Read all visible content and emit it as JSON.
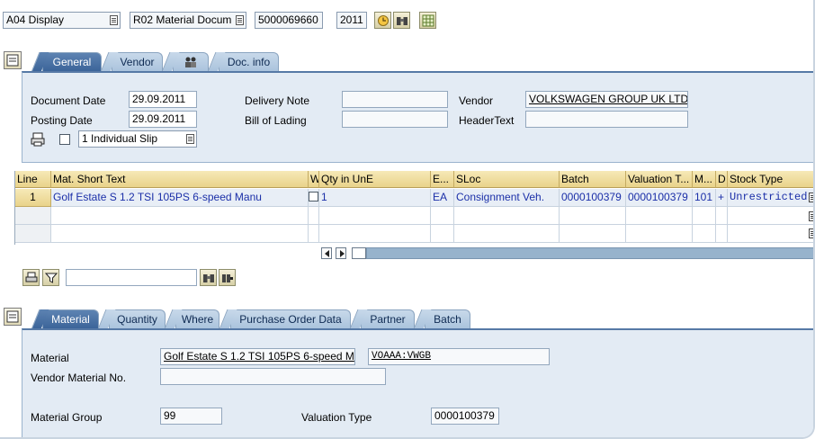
{
  "toolbar": {
    "action": "A04 Display",
    "document_type": "R02 Material Docum",
    "document_number": "5000069660",
    "year": "2011"
  },
  "header_tabs": {
    "general": "General",
    "vendor": "Vendor",
    "doc_info": "Doc. info"
  },
  "general": {
    "document_date_label": "Document Date",
    "document_date": "29.09.2011",
    "posting_date_label": "Posting Date",
    "posting_date": "29.09.2011",
    "slip_option": "1 Individual Slip",
    "delivery_note_label": "Delivery Note",
    "delivery_note": "",
    "bill_of_lading_label": "Bill of Lading",
    "bill_of_lading": "",
    "vendor_label": "Vendor",
    "vendor": "VOLKSWAGEN GROUP UK LTD",
    "header_text_label": "HeaderText",
    "header_text": ""
  },
  "items_table": {
    "columns": [
      "Line",
      "Mat. Short Text",
      "W",
      "Qty in UnE",
      "E...",
      "SLoc",
      "Batch",
      "Valuation T...",
      "M...",
      "D",
      "Stock Type"
    ],
    "rows": [
      {
        "line": "1",
        "mat_short_text": "Golf Estate S 1.2 TSI 105PS 6-speed Manu",
        "qty": "1",
        "unit": "EA",
        "sloc": "Consignment Veh.",
        "batch": "0000100379",
        "valuation_type": "0000100379",
        "movement": "101",
        "debit": "+",
        "stock_type": "Unrestricted"
      }
    ]
  },
  "item_tabs": [
    "Material",
    "Quantity",
    "Where",
    "Purchase Order Data",
    "Partner",
    "Batch"
  ],
  "material_detail": {
    "material_label": "Material",
    "material_text": "Golf Estate S 1.2 TSI 105PS 6-speed M",
    "material_code": "VOAAA:VWGB",
    "vendor_material_no_label": "Vendor Material No.",
    "vendor_material_no": "",
    "material_group_label": "Material Group",
    "material_group": "99",
    "valuation_type_label": "Valuation Type",
    "valuation_type": "0000100379"
  },
  "colors": {
    "tab_active": "#3a6398",
    "tab_inactive": "#b8cde3",
    "panel_bg": "#e3ebf4",
    "table_header": "#efdda0",
    "link_text": "#1b2fa8"
  }
}
